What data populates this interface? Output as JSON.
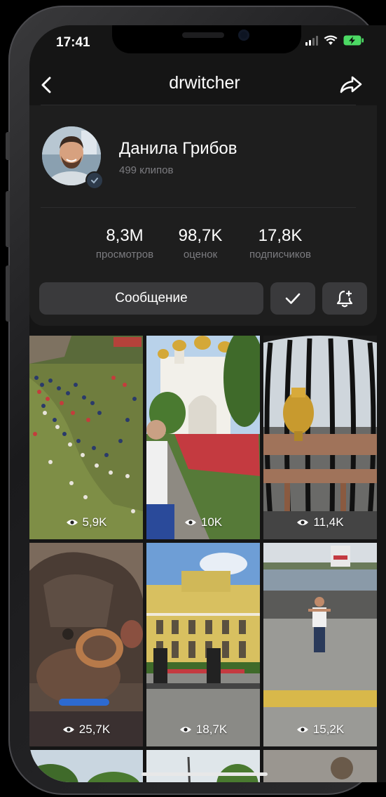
{
  "status_bar": {
    "time": "17:41"
  },
  "header": {
    "title": "drwitcher",
    "back_icon": "chevron-left-icon",
    "share_icon": "share-arrow-icon"
  },
  "profile": {
    "name": "Данила Грибов",
    "clips": "499 клипов",
    "verified": true
  },
  "stats": [
    {
      "value": "8,3M",
      "label": "просмотров"
    },
    {
      "value": "98,7K",
      "label": "оценок"
    },
    {
      "value": "17,8K",
      "label": "подписчиков"
    }
  ],
  "actions": {
    "message_label": "Сообщение",
    "subscribed_icon": "checkmark-icon",
    "notify_icon": "bell-add-icon"
  },
  "videos": [
    {
      "views": "5,9K",
      "scene": "crowd-festival-aerial"
    },
    {
      "views": "10K",
      "scene": "white-cathedral-tulips"
    },
    {
      "views": "11,4K",
      "scene": "samovar-pavilion"
    },
    {
      "views": "25,7K",
      "scene": "bronze-ring-sculpture"
    },
    {
      "views": "18,7K",
      "scene": "yellow-theater-building"
    },
    {
      "views": "15,2K",
      "scene": "man-on-embankment"
    }
  ],
  "colors": {
    "background": "#151515",
    "card": "#1e1e1e",
    "button": "#3a3a3c",
    "text": "#ffffff",
    "muted": "#7c7c80",
    "battery": "#4cd964"
  }
}
